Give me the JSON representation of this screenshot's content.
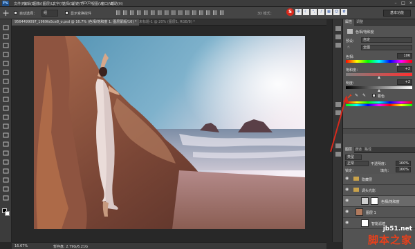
{
  "app": {
    "logo": "Ps"
  },
  "menu": [
    "文件(F)",
    "编辑(E)",
    "图像(I)",
    "图层(L)",
    "文字(Y)",
    "选择(S)",
    "滤镜(T)",
    "3D(D)",
    "视图(V)",
    "窗口(W)",
    "帮助(H)"
  ],
  "toolbar": {
    "auto_select_label": "自动选择：",
    "auto_select_value": "组",
    "show_transform_label": "显示变换控件",
    "mode_3d_label": "3D 模式：",
    "workspace": "基本功能"
  },
  "sogou": {
    "s": "S",
    "zh": "中"
  },
  "tabs": [
    {
      "label": "9564499097_1969fa5ce8_o.psd @ 16.7% (色相/饱和度 1, 图层蒙版/16) *"
    },
    {
      "label": "未标题-1 @ 20% (图层1, RGB/8) *"
    }
  ],
  "status": {
    "zoom": "16.67%",
    "doc": "暂存盘: 2.79G/6.21G"
  },
  "properties_panel": {
    "tabs": [
      "属性",
      "调整"
    ],
    "title": "色相/饱和度",
    "preset_label": "预设：",
    "preset_value": "自定",
    "channel_value": "全图",
    "hue_label": "色相：",
    "hue_value": "106",
    "hue_fraction": 0.79,
    "saturation_label": "饱和度：",
    "saturation_value": "+2",
    "saturation_fraction": 0.51,
    "lightness_label": "明度：",
    "lightness_value": "+2",
    "lightness_fraction": 0.51,
    "colorize_label": "着色"
  },
  "layers_panel": {
    "tabs": [
      "图层",
      "通道",
      "路径"
    ],
    "kind_label": "类型",
    "blend_mode": "正常",
    "opacity_label": "不透明度：",
    "opacity_value": "100%",
    "lock_label": "锁定：",
    "fill_label": "填充：",
    "fill_value": "100%",
    "layers": [
      {
        "name": "隐藏层"
      },
      {
        "name": "调头光影"
      },
      {
        "name": "色相/饱和度"
      },
      {
        "name": "图层 1"
      },
      {
        "name": "智能滤镜"
      }
    ]
  },
  "watermark": {
    "site": "jb51.net",
    "brand": "脚本之家"
  },
  "colors": {
    "accent_red": "#e8401c",
    "panel_bg": "#535353",
    "chrome_bg": "#3c3c3c"
  }
}
